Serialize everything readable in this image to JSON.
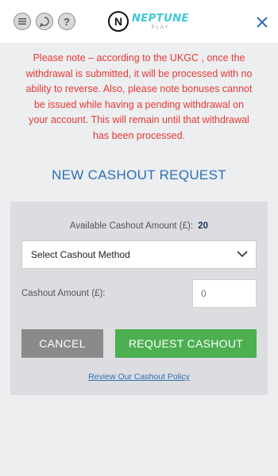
{
  "header": {
    "logo_name": "NEPTUNE",
    "logo_sub": "PLAY",
    "help_glyph": "?"
  },
  "notice": "Please note – according to the UKGC , once the withdrawal is submitted, it will be processed with no ability to reverse. Also, please note bonuses cannot be issued while having a pending withdrawal on your account. This will remain until that withdrawal has been processed.",
  "form": {
    "title": "NEW CASHOUT REQUEST",
    "available_label": "Available Cashout Amount (£):",
    "available_value": "20",
    "method_select": "Select Cashout Method",
    "amount_label": "Cashout Amount (£):",
    "amount_placeholder": "0",
    "cancel_label": "CANCEL",
    "request_label": "REQUEST CASHOUT",
    "policy_link": "Review Our Cashout Policy"
  },
  "colors": {
    "notice_red": "#e53935",
    "accent_blue": "#2f6fb5",
    "request_green": "#4caf50",
    "cancel_grey": "#8a8a8a"
  }
}
